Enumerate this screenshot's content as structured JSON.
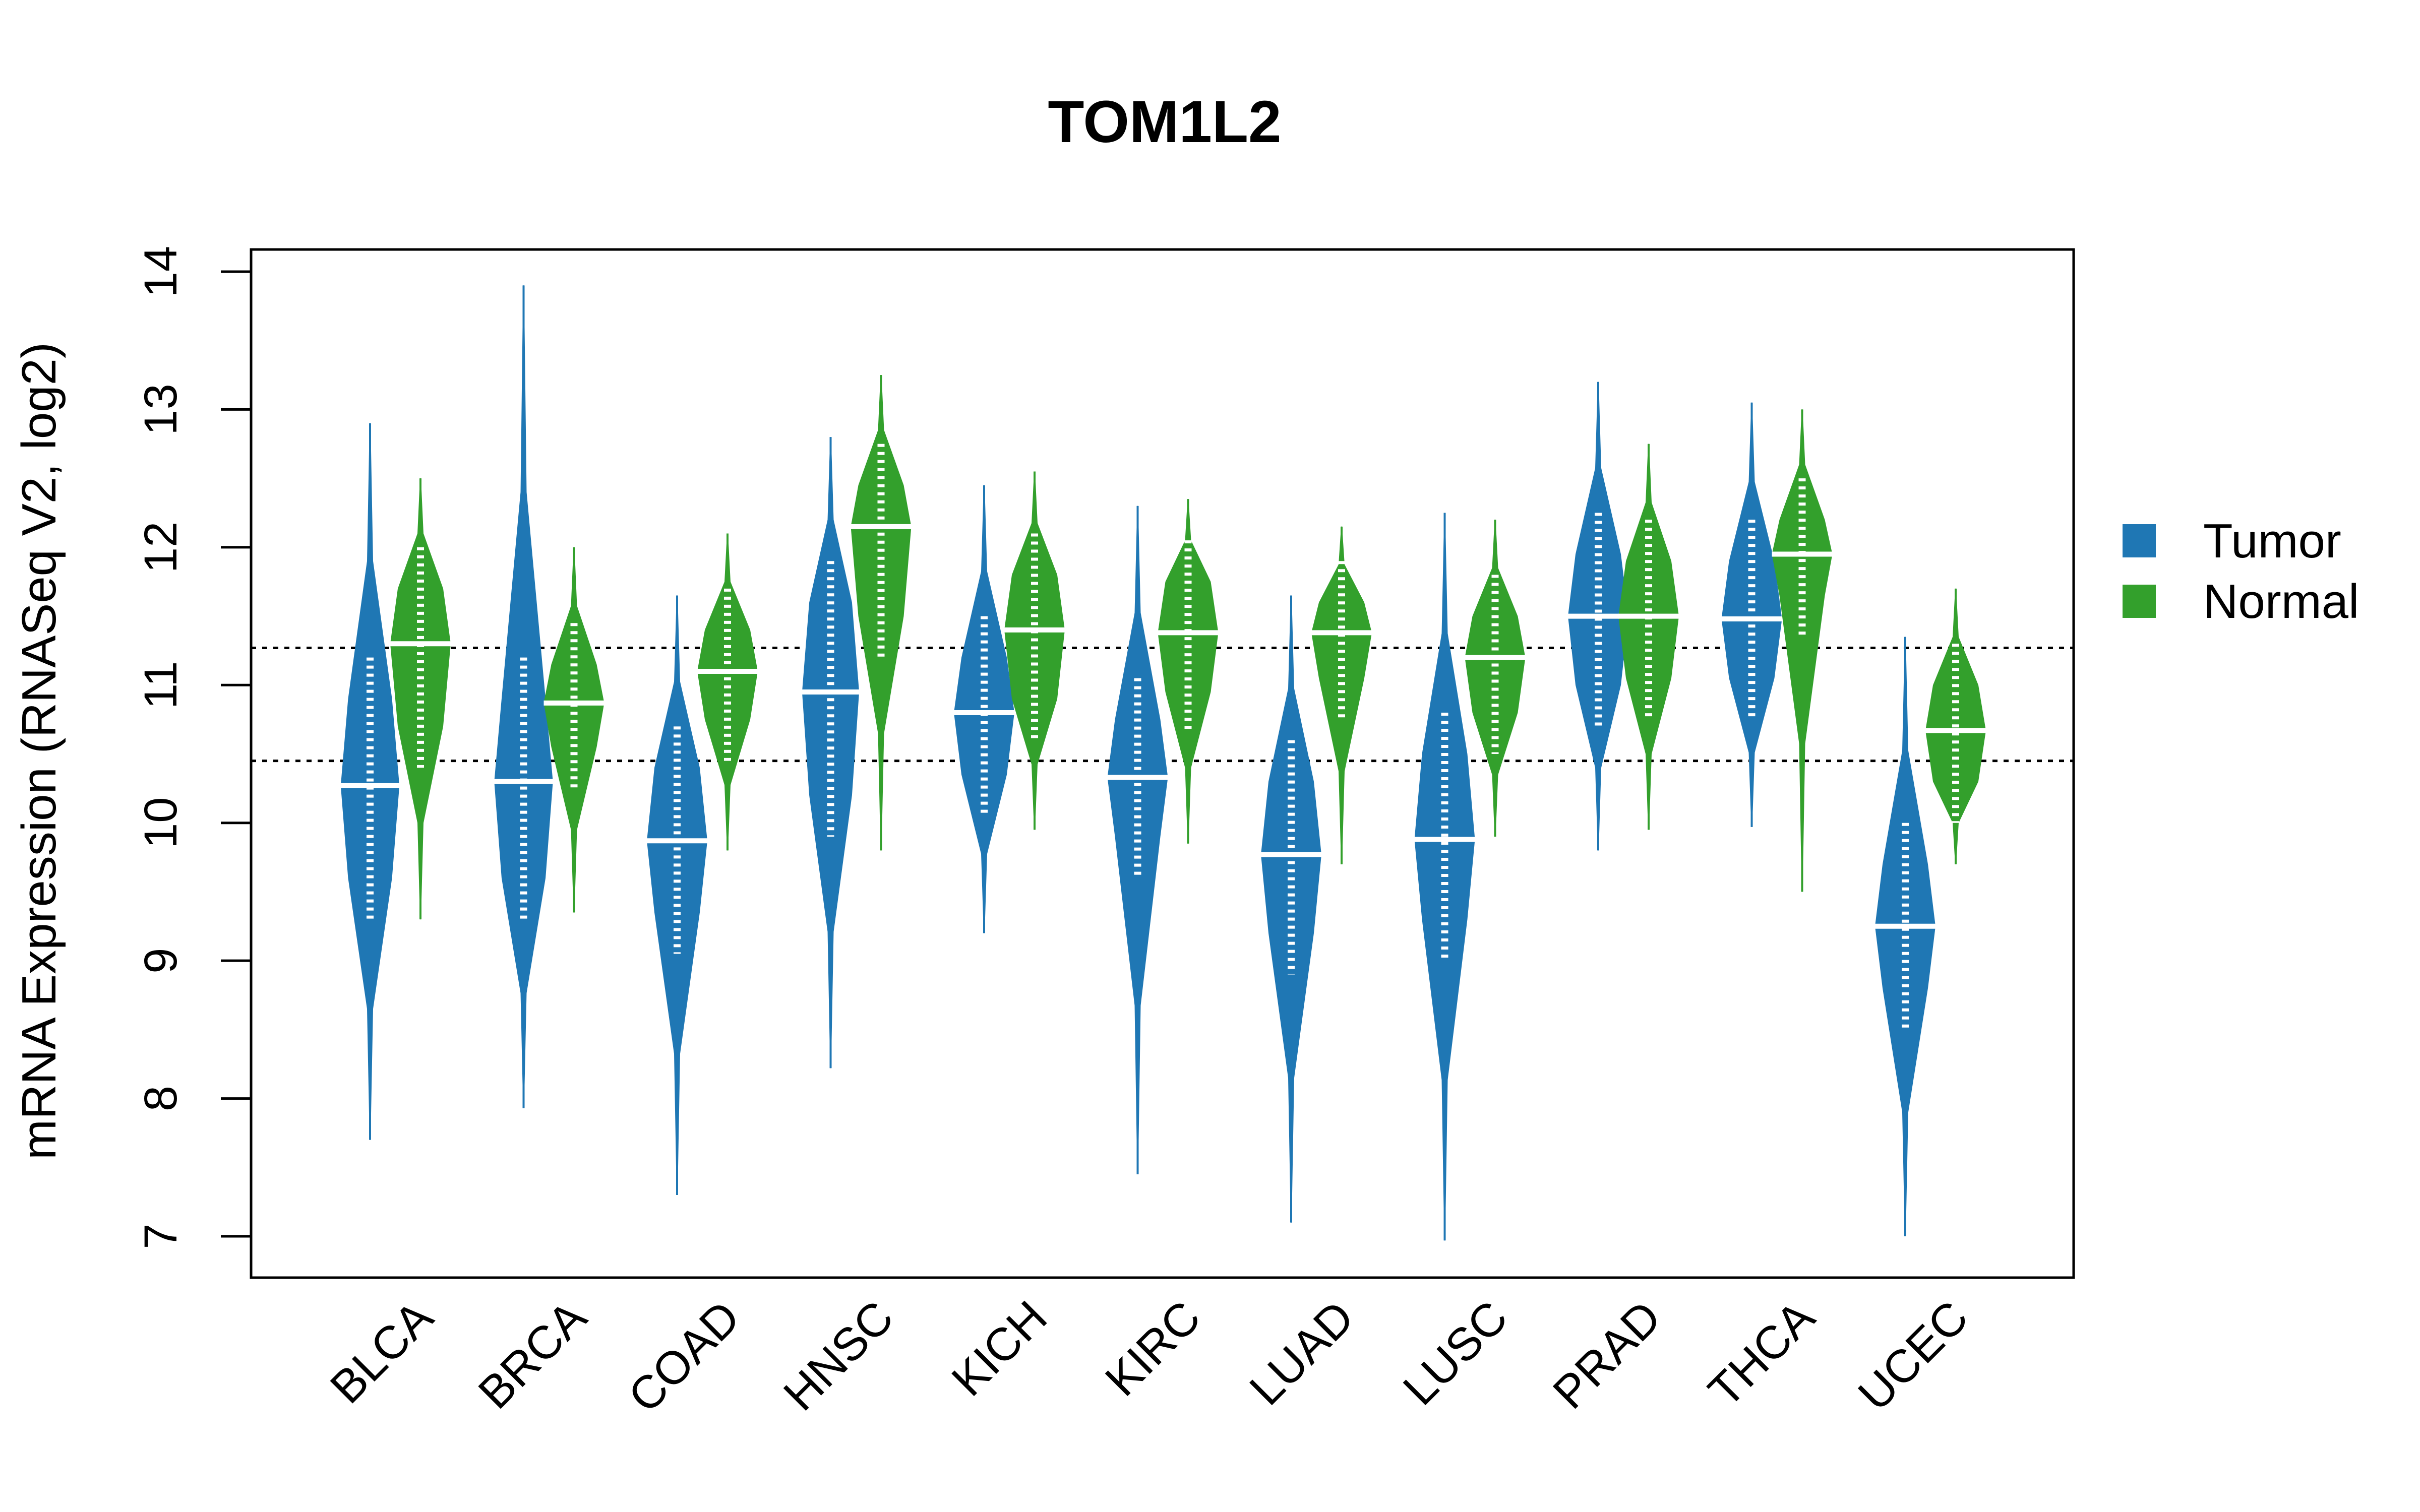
{
  "chart_data": {
    "type": "violin",
    "title": "TOM1L2",
    "xlabel": "",
    "ylabel": "mRNA Expression (RNASeq V2, log2)",
    "ylim": [
      6.85,
      14.15
    ],
    "yticks": [
      "7",
      "8",
      "9",
      "10",
      "11",
      "12",
      "13",
      "14"
    ],
    "ytick_values": [
      7,
      8,
      9,
      10,
      11,
      12,
      13,
      14
    ],
    "categories": [
      "BLCA",
      "BRCA",
      "COAD",
      "HNSC",
      "KICH",
      "KIRC",
      "LUAD",
      "LUSC",
      "PRAD",
      "THCA",
      "UCEC"
    ],
    "reference_lines": [
      11.27,
      10.45
    ],
    "legend": {
      "position": "right",
      "entries": [
        {
          "name": "Tumor",
          "color": "#1F77B4"
        },
        {
          "name": "Normal",
          "color": "#33A02C"
        }
      ]
    },
    "series": [
      {
        "name": "Tumor",
        "color": "#1F77B4",
        "median": [
          10.27,
          10.3,
          9.87,
          10.95,
          10.8,
          10.33,
          9.77,
          9.88,
          11.5,
          11.48,
          9.25
        ],
        "min": [
          7.7,
          7.93,
          7.3,
          8.22,
          9.2,
          7.45,
          7.1,
          6.97,
          9.8,
          9.97,
          7.0
        ],
        "max": [
          12.9,
          13.9,
          11.65,
          12.8,
          12.45,
          12.3,
          11.65,
          12.25,
          13.2,
          13.05,
          11.35
        ],
        "q1": [
          9.6,
          9.6,
          9.35,
          10.2,
          10.35,
          9.9,
          9.2,
          9.3,
          11.0,
          11.05,
          8.8
        ],
        "q3": [
          10.9,
          10.9,
          10.4,
          11.6,
          11.2,
          10.75,
          10.3,
          10.5,
          11.95,
          11.9,
          9.7
        ]
      },
      {
        "name": "Normal",
        "color": "#33A02C",
        "median": [
          11.3,
          10.87,
          11.1,
          12.15,
          11.4,
          11.38,
          11.38,
          11.2,
          11.5,
          11.95,
          10.67
        ],
        "min": [
          9.3,
          9.35,
          9.8,
          9.8,
          9.95,
          9.85,
          9.7,
          9.9,
          9.95,
          9.5,
          9.7
        ],
        "max": [
          12.5,
          12.0,
          12.1,
          13.25,
          12.55,
          12.35,
          12.15,
          12.2,
          12.75,
          13.0,
          11.7
        ],
        "q1": [
          10.7,
          10.55,
          10.75,
          11.5,
          10.9,
          10.95,
          11.05,
          10.8,
          11.05,
          11.65,
          10.3
        ],
        "q3": [
          11.7,
          11.15,
          11.4,
          12.45,
          11.8,
          11.75,
          11.6,
          11.5,
          11.9,
          12.2,
          11.0
        ]
      }
    ]
  }
}
